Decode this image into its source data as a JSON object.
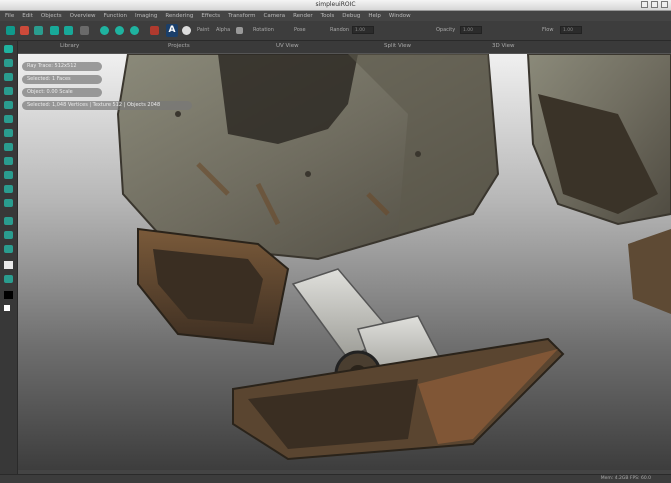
{
  "window": {
    "title": "simpleuiROIC"
  },
  "menubar": {
    "items": [
      "File",
      "Edit",
      "Objects",
      "Overview",
      "Function",
      "Imaging",
      "Rendering",
      "Effects",
      "Transform",
      "Camera",
      "Render",
      "Tools",
      "Debug",
      "Help",
      "Window"
    ]
  },
  "toolbar": {
    "labels": {
      "paint": "Paint",
      "alpha": "Alpha",
      "rotation": "Rotation",
      "pose": "Pose",
      "randon": "Randon",
      "opacity": "Opacity",
      "flow": "Flow"
    },
    "field_values": [
      "1.00",
      "1.00",
      "1.00"
    ]
  },
  "panel_tabs": [
    "Library",
    "Projects",
    "UV View",
    "Split View",
    "3D View"
  ],
  "viewport": {
    "overlay_items": [
      "Ray Trace: 512x512",
      "Selected: 1 Faces",
      "Object: 0.00 Scale",
      "Selected: 1,048 Vertices | Texture 512 | Objects 2048"
    ]
  },
  "status": {
    "right_text": "Mem: 4.2GB  FPS: 60.0"
  },
  "colors": {
    "accent": "#2a9d8f",
    "teal": "#0f9a8c",
    "panel": "#3d3d3d"
  }
}
